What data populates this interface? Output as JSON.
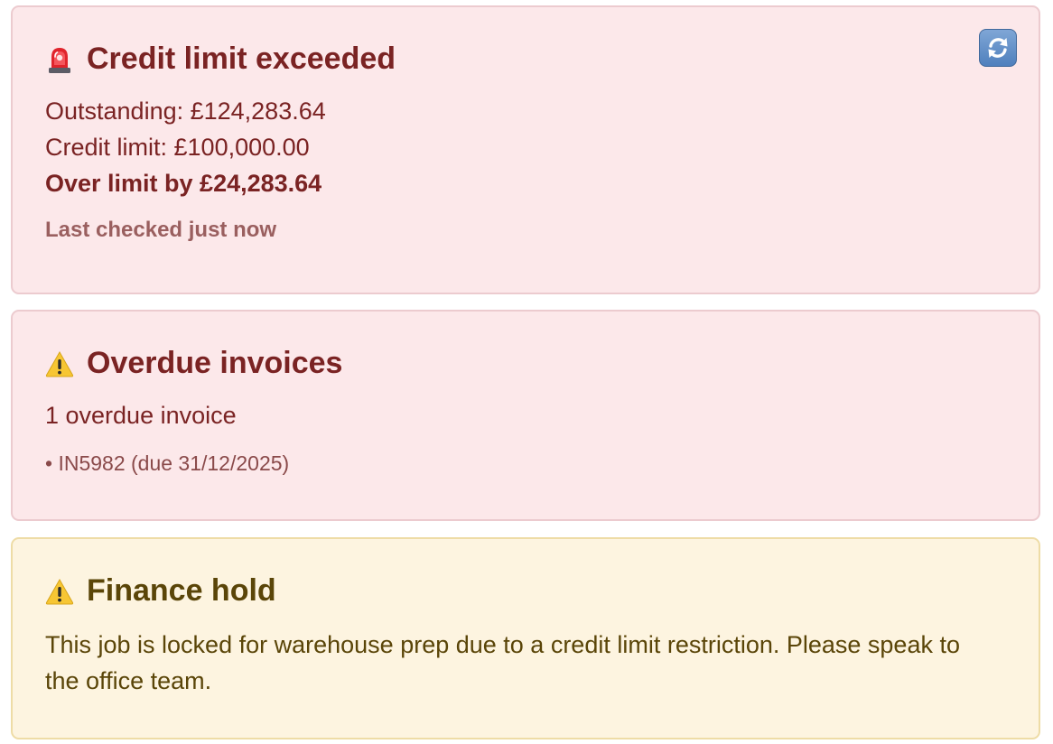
{
  "credit": {
    "title": "Credit limit exceeded",
    "title_icon": "siren-icon",
    "outstanding": "Outstanding: £124,283.64",
    "credit_limit": "Credit limit: £100,000.00",
    "over_limit": "Over limit by £24,283.64",
    "last_checked": "Last checked just now",
    "refresh_icon": "refresh-icon"
  },
  "overdue": {
    "title": "Overdue invoices",
    "title_icon": "warning-icon",
    "count_text": "1 overdue invoice",
    "items": [
      "• IN5982 (due 31/12/2025)"
    ]
  },
  "hold": {
    "title": "Finance hold",
    "title_icon": "warning-icon",
    "message": "This job is locked for warehouse prep due to a credit limit restriction. Please speak to the office team."
  },
  "colors": {
    "danger_bg": "#fce8ea",
    "danger_border": "#eccbcf",
    "danger_text": "#7a2323",
    "warn_bg": "#fdf4e0",
    "warn_border": "#eedca6",
    "warn_text": "#5a4508",
    "refresh_button": "#5b8bc6"
  }
}
